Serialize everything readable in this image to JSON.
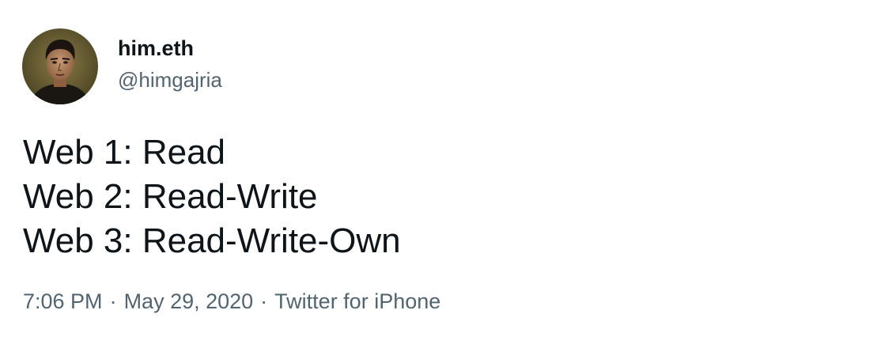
{
  "author": {
    "display_name": "him.eth",
    "handle": "@himgajria",
    "avatar_icon": "profile-photo"
  },
  "tweet": {
    "lines": [
      "Web 1: Read",
      "Web 2: Read-Write",
      "Web 3: Read-Write-Own"
    ]
  },
  "meta": {
    "time": "7:06 PM",
    "separator": "·",
    "date": "May 29, 2020",
    "source": "Twitter for iPhone"
  },
  "colors": {
    "text_primary": "#0f1419",
    "text_secondary": "#536471",
    "background": "#ffffff"
  }
}
